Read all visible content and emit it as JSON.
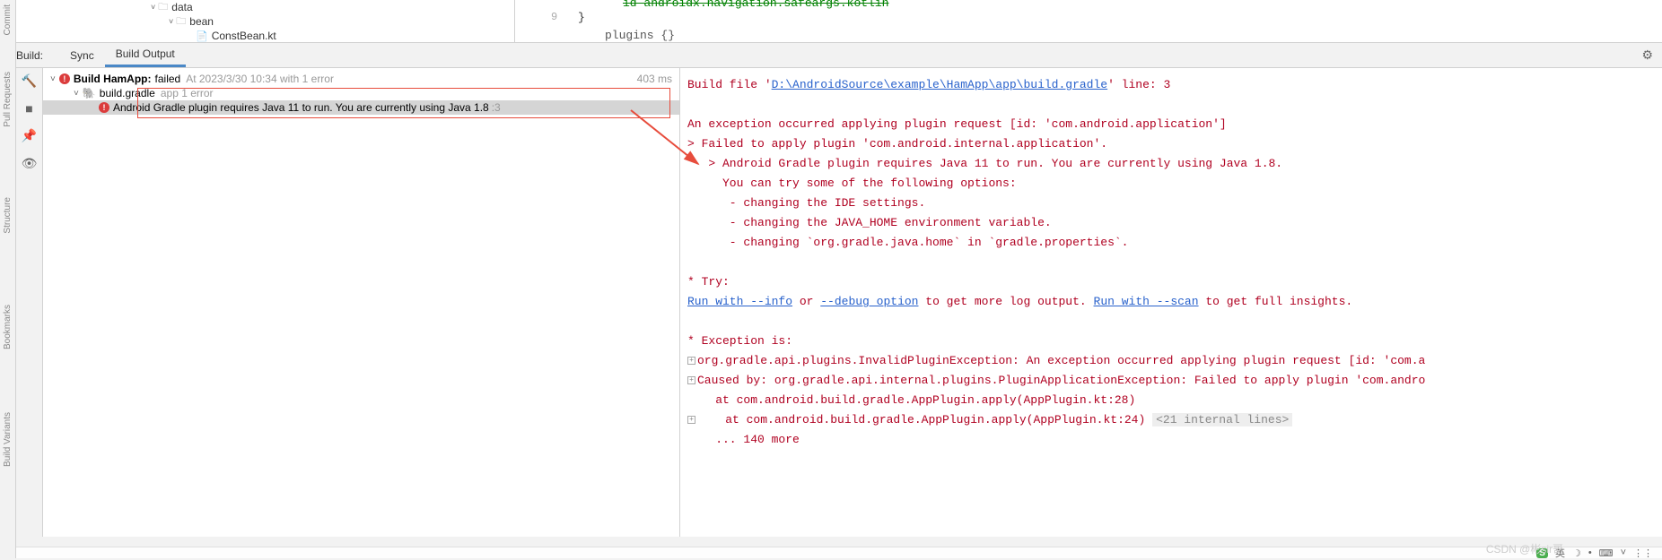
{
  "tree": {
    "item1": {
      "arrow": "˅",
      "name": "data"
    },
    "item2": {
      "arrow": "˅",
      "name": "bean"
    },
    "item3": {
      "name": "ConstBean.kt"
    }
  },
  "editor": {
    "line_num_9": "9",
    "green_line": "id  androidx.navigation.safeargs.kotlin",
    "close_brace": "}",
    "plugins": "plugins {}"
  },
  "tabs": {
    "build_label": "Build:",
    "sync": "Sync",
    "output": "Build Output"
  },
  "build_tree": {
    "root_label": "Build HamApp:",
    "root_status": "failed",
    "root_meta": "At 2023/3/30 10:34 with 1 error",
    "root_duration": "403 ms",
    "gradle_label": "build.gradle",
    "gradle_meta": "app 1 error",
    "error_msg": "Android Gradle plugin requires Java 11 to run. You are currently using Java 1.8",
    "error_suffix": ":3"
  },
  "detail": {
    "l1_prefix": "Build file '",
    "l1_link": "D:\\AndroidSource\\example\\HamApp\\app\\build.gradle",
    "l1_suffix": "' line: 3",
    "l3": "An exception occurred applying plugin request [id: 'com.android.application']",
    "l4": "> Failed to apply plugin 'com.android.internal.application'.",
    "l5": "   > Android Gradle plugin requires Java 11 to run. You are currently using Java 1.8.",
    "l6": "     You can try some of the following options:",
    "l7": "      - changing the IDE settings.",
    "l8": "      - changing the JAVA_HOME environment variable.",
    "l9": "      - changing `org.gradle.java.home` in `gradle.properties`.",
    "l11": "* Try:",
    "l12_link1": "Run with --info",
    "l12_mid1": " or ",
    "l12_link2": "--debug option",
    "l12_mid2": " to get more log output. ",
    "l12_link3": "Run with --scan",
    "l12_end": " to get full insights.",
    "l14": "* Exception is:",
    "l15": "org.gradle.api.plugins.InvalidPluginException: An exception occurred applying plugin request [id: 'com.a",
    "l16": "Caused by: org.gradle.api.internal.plugins.PluginApplicationException: Failed to apply plugin 'com.andro",
    "l17": "    at com.android.build.gradle.AppPlugin.apply(AppPlugin.kt:28)",
    "l18": "    at com.android.build.gradle.AppPlugin.apply(AppPlugin.kt:24)",
    "l18_internal": "<21 internal lines>",
    "l19": "    ... 140 more"
  },
  "vbars": {
    "commit": "Commit",
    "pull": "Pull Requests",
    "structure": "Structure",
    "bookmarks": "Bookmarks",
    "variants": "Build Variants"
  },
  "status": {
    "watermark": "CSDN @彬sir哥",
    "ime": "S",
    "lang": "英",
    "menu": "⋮⋮"
  }
}
